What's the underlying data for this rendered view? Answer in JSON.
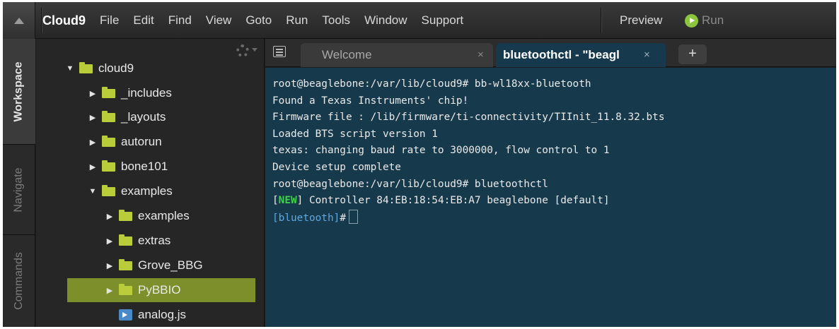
{
  "menubar": {
    "brand": "Cloud9",
    "items": [
      "File",
      "Edit",
      "Find",
      "View",
      "Goto",
      "Run",
      "Tools",
      "Window",
      "Support"
    ],
    "preview_label": "Preview",
    "run_label": "Run",
    "run_icon": "play-circle-icon",
    "run_icon_color": "#8cc63f"
  },
  "sidetabs": {
    "workspace": "Workspace",
    "navigate": "Navigate",
    "commands": "Commands"
  },
  "tree": {
    "gear_icon": "gear-icon",
    "nodes": [
      {
        "label": "cloud9",
        "expanded": true,
        "kind": "folder"
      },
      {
        "label": "_includes",
        "expanded": false,
        "kind": "folder"
      },
      {
        "label": "_layouts",
        "expanded": false,
        "kind": "folder"
      },
      {
        "label": "autorun",
        "expanded": false,
        "kind": "folder"
      },
      {
        "label": "bone101",
        "expanded": false,
        "kind": "folder"
      },
      {
        "label": "examples",
        "expanded": true,
        "kind": "folder"
      },
      {
        "label": "examples",
        "expanded": false,
        "kind": "folder"
      },
      {
        "label": "extras",
        "expanded": false,
        "kind": "folder"
      },
      {
        "label": "Grove_BBG",
        "expanded": false,
        "kind": "folder"
      },
      {
        "label": "PyBBIO",
        "expanded": false,
        "kind": "folder",
        "selected": true
      },
      {
        "label": "analog.js",
        "kind": "file"
      }
    ],
    "folder_color": "#b9cc3a",
    "selection_color": "#7d8f2a"
  },
  "tabs": {
    "welcome_label": "Welcome",
    "terminal_label": "bluetoothctl - \"beagl",
    "close_symbol": "×",
    "add_symbol": "+"
  },
  "terminal": {
    "lines": [
      "root@beaglebone:/var/lib/cloud9# bb-wl18xx-bluetooth",
      "Found a Texas Instruments' chip!",
      "Firmware file : /lib/firmware/ti-connectivity/TIInit_11.8.32.bts",
      "Loaded BTS script version 1",
      "texas: changing baud rate to 3000000, flow control to 1",
      "Device setup complete",
      "root@beaglebone:/var/lib/cloud9# bluetoothctl"
    ],
    "new_tag": "NEW",
    "new_bracket_open": "[",
    "new_bracket_close": "]",
    "new_line_rest": " Controller 84:EB:18:54:EB:A7 beaglebone [default]",
    "prompt": "[bluetooth]",
    "prompt_suffix": "#",
    "background_color": "#16394c",
    "new_tag_color": "#3fd14a"
  }
}
